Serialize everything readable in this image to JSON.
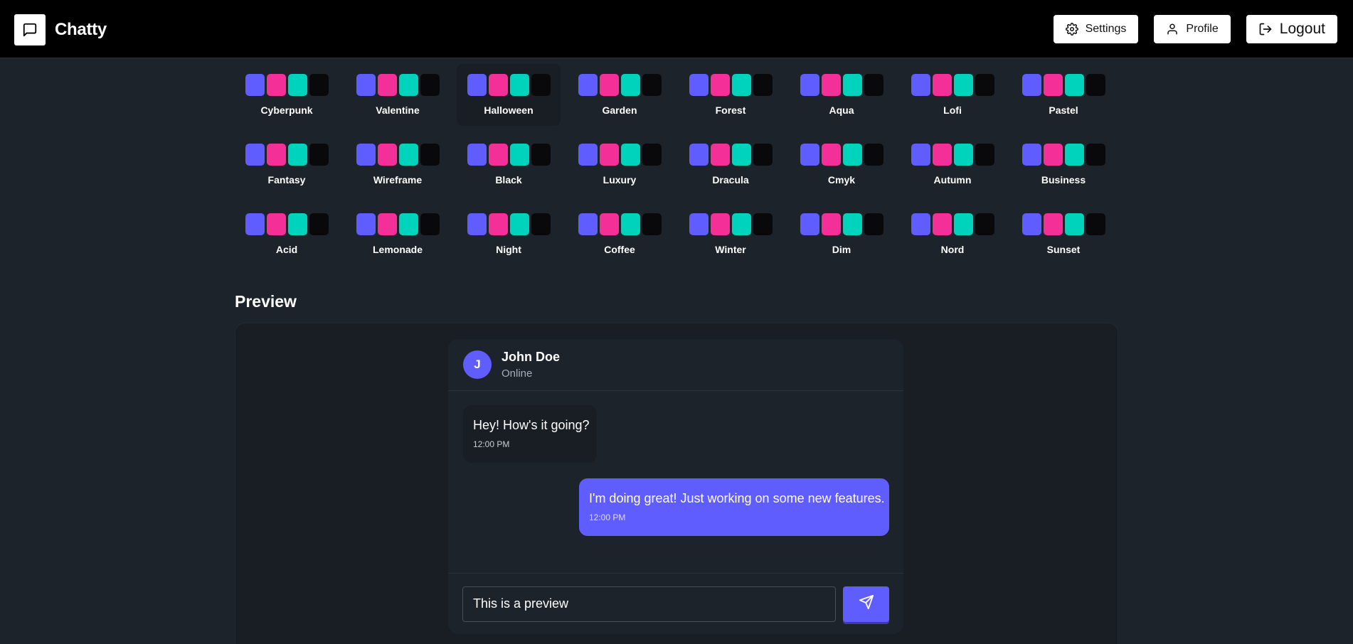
{
  "app": {
    "name": "Chatty",
    "brand_icon": "message-square-icon"
  },
  "nav": {
    "settings_label": "Settings",
    "profile_label": "Profile",
    "logout_label": "Logout"
  },
  "theme_swatch_colors": [
    "#605dff",
    "#f43098",
    "#00d3bb",
    "#09090b"
  ],
  "themes": [
    {
      "label": "Cyberpunk"
    },
    {
      "label": "Valentine"
    },
    {
      "label": "Halloween",
      "active": true
    },
    {
      "label": "Garden"
    },
    {
      "label": "Forest"
    },
    {
      "label": "Aqua"
    },
    {
      "label": "Lofi"
    },
    {
      "label": "Pastel"
    },
    {
      "label": "Fantasy"
    },
    {
      "label": "Wireframe"
    },
    {
      "label": "Black"
    },
    {
      "label": "Luxury"
    },
    {
      "label": "Dracula"
    },
    {
      "label": "Cmyk"
    },
    {
      "label": "Autumn"
    },
    {
      "label": "Business"
    },
    {
      "label": "Acid"
    },
    {
      "label": "Lemonade"
    },
    {
      "label": "Night"
    },
    {
      "label": "Coffee"
    },
    {
      "label": "Winter"
    },
    {
      "label": "Dim"
    },
    {
      "label": "Nord"
    },
    {
      "label": "Sunset"
    }
  ],
  "preview": {
    "title": "Preview",
    "contact": {
      "initial": "J",
      "name": "John Doe",
      "status": "Online"
    },
    "messages": [
      {
        "text": "Hey! How's it going?",
        "time": "12:00 PM",
        "direction": "incoming"
      },
      {
        "text": "I'm doing great! Just working on some new features.",
        "time": "12:00 PM",
        "direction": "outgoing"
      }
    ],
    "input_value": "This is a preview",
    "send_icon": "send-icon"
  },
  "colors": {
    "navbar_bg": "#000000",
    "page_bg": "#1d232a",
    "accent": "#605dff"
  }
}
